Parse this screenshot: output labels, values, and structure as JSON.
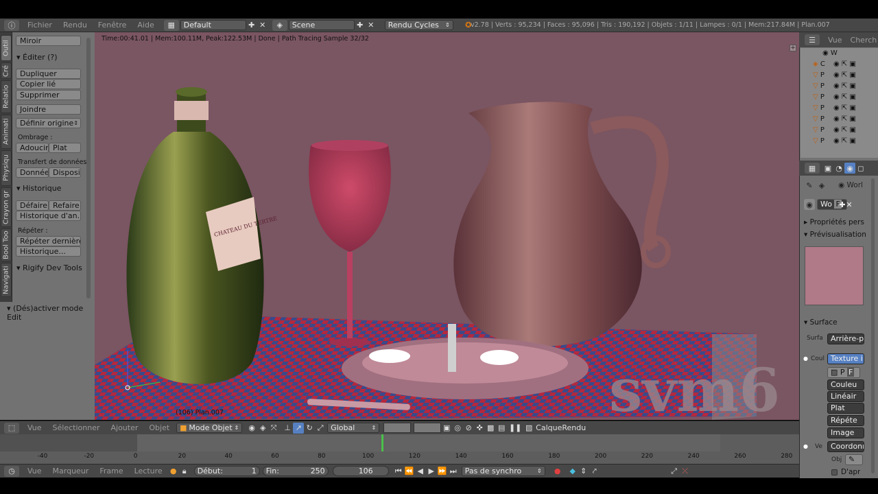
{
  "menubar": {
    "items": [
      "Fichier",
      "Rendu",
      "Fenêtre",
      "Aide"
    ],
    "screen_layout": "Default",
    "scene": "Scene",
    "render_engine": "Rendu Cycles",
    "stats": "v2.78 | Verts : 95,234 | Faces : 95,096 | Tris : 190,192 | Objets : 1/11 | Lampes : 0/1 | Mem:217.84M | Plan.007"
  },
  "toolshelf": {
    "tabs": [
      "Outil",
      "Cré",
      "Relatio",
      "Animati",
      "Physiqu",
      "Crayon gr",
      "Bool Too",
      "Navigati"
    ],
    "miroir": "Miroir",
    "editer_header": "Éditer (?)",
    "dupliquer": "Dupliquer",
    "copier_lie": "Copier lié",
    "supprimer": "Supprimer",
    "joindre": "Joindre",
    "definir_origine": "Définir origine",
    "ombrage_label": "Ombrage :",
    "adoucir": "Adoucir",
    "plat": "Plat",
    "transfert_label": "Transfert de données :",
    "donnee": "Donnée",
    "disposition": "Dispositi",
    "historique_header": "Historique",
    "defaire": "Défaire",
    "refaire": "Refaire",
    "historique_an": "Historique d'an...",
    "repeter_label": "Répéter :",
    "repeter_derniere": "Répéter dernière",
    "historique2": "Historique...",
    "rigify": "Rigify Dev Tools",
    "operator_panel": "(Dés)activer mode Edit"
  },
  "viewport": {
    "render_info": "Time:00:41.01 | Mem:100.11M, Peak:122.53M | Done | Path Tracing Sample 32/32",
    "object_label": "(106) Plan.007",
    "watermark": "svm6",
    "label_text": "CHATEAU DU TERTRE"
  },
  "viewport_header": {
    "vue": "Vue",
    "selectionner": "Sélectionner",
    "ajouter": "Ajouter",
    "objet": "Objet",
    "mode": "Mode Objet",
    "orientation": "Global",
    "layer": "CalqueRendu"
  },
  "timeline": {
    "ticks": [
      "-40",
      "-20",
      "0",
      "20",
      "40",
      "60",
      "80",
      "100",
      "120",
      "140",
      "160",
      "180",
      "200",
      "220",
      "240",
      "260",
      "280"
    ],
    "current_frame_marker": 106
  },
  "timeline_bar": {
    "vue": "Vue",
    "marqueur": "Marqueur",
    "frame": "Frame",
    "lecture": "Lecture",
    "debut_label": "Début:",
    "debut_value": "1",
    "fin_label": "Fin:",
    "fin_value": "250",
    "current": "106",
    "sync": "Pas de synchro"
  },
  "outliner": {
    "vue": "Vue",
    "search": "Cherch",
    "world_row": "W",
    "rows": [
      "C",
      "P",
      "P",
      "P",
      "P",
      "P",
      "P",
      "P"
    ]
  },
  "properties": {
    "world_crumb": "Worl",
    "world_name": "Wo",
    "fake_user": "F",
    "proprietes": "Propriétés pers",
    "previsualisation": "Prévisualisation",
    "surface": "Surface",
    "surfa_label": "Surfa",
    "arriere_plan": "Arrière-pl",
    "coul_label": "Coul",
    "texture": "Texture i",
    "p_btn": "P",
    "f_btn": "F",
    "couleur": "Couleu",
    "lineaire": "Linéair",
    "plat": "Plat",
    "repeter": "Répéte",
    "image": "Image",
    "ve_label": "Ve",
    "coordonnees": "Coordonn",
    "obj_label": "Obj",
    "dapr": "D'apr"
  },
  "colors": {
    "viewport_bg": "#7a5562",
    "header": "#474747",
    "panel": "#727272",
    "accent_blue": "#5680c2"
  }
}
